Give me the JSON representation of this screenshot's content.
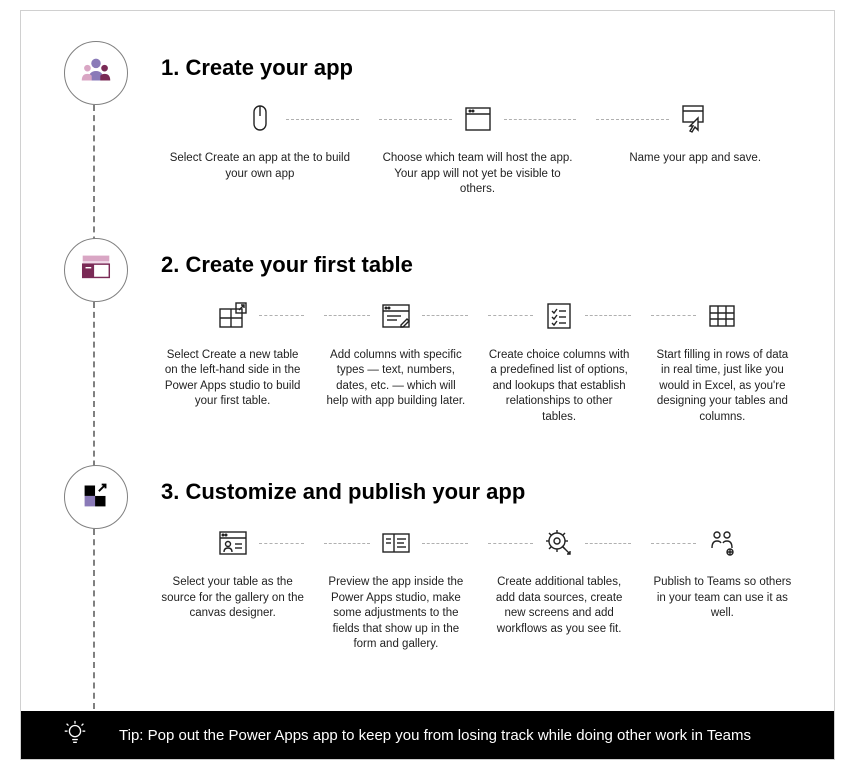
{
  "steps": [
    {
      "title": "1. Create your app",
      "cols": [
        {
          "text": "Select Create an app at the to build your own app"
        },
        {
          "text": "Choose which team will host the app. Your app will not yet be visible to others."
        },
        {
          "text": "Name your app and save."
        }
      ]
    },
    {
      "title": "2. Create your first table",
      "cols": [
        {
          "text": "Select Create a new table on the left-hand side in the Power Apps studio to build your first table."
        },
        {
          "text": "Add columns with specific types — text, numbers, dates, etc. — which will help with app building later."
        },
        {
          "text": "Create choice columns with a predefined list of options, and lookups that establish relationships to other tables."
        },
        {
          "text": "Start filling in rows of data in real time, just like you would in Excel, as you're designing your tables and columns."
        }
      ]
    },
    {
      "title": "3. Customize and publish your app",
      "cols": [
        {
          "text": "Select your table as the source for the gallery on the canvas designer."
        },
        {
          "text": "Preview the app inside the Power Apps studio, make some adjustments to the fields that show up in the form and gallery."
        },
        {
          "text": "Create additional tables, add data sources, create new screens and add workflows as you see fit."
        },
        {
          "text": "Publish to Teams so others in your team can use it as well."
        }
      ]
    }
  ],
  "tip": "Tip: Pop out the Power Apps app to keep you from losing track while doing other work in Teams"
}
